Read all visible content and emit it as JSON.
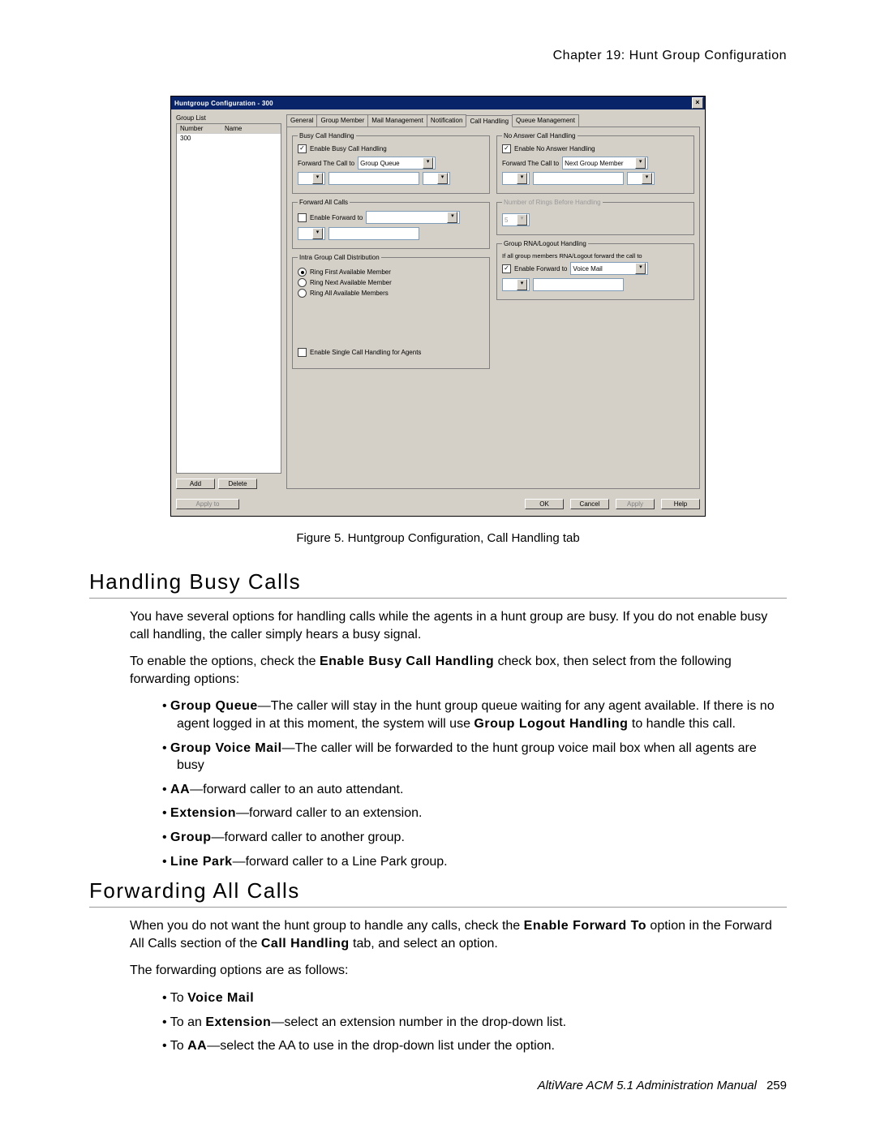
{
  "header": {
    "chapter": "Chapter 19:  Hunt Group Configuration"
  },
  "dialog": {
    "title": "Huntgroup Configuration - 300",
    "grouplist": {
      "label": "Group List",
      "col_number": "Number",
      "col_name": "Name",
      "row_number": "300",
      "add": "Add",
      "delete": "Delete"
    },
    "tabs": {
      "general": "General",
      "group_member": "Group Member",
      "mail_mgmt": "Mail Management",
      "notification": "Notification",
      "call_handling": "Call Handling",
      "queue_mgmt": "Queue Management"
    },
    "busy": {
      "legend": "Busy Call Handling",
      "enable": "Enable Busy Call Handling",
      "fwd_label": "Forward The Call to",
      "fwd_value": "Group Queue"
    },
    "fwdall": {
      "legend": "Forward All Calls",
      "enable": "Enable Forward to"
    },
    "intra": {
      "legend": "Intra Group Call Distribution",
      "r1": "Ring First Available Member",
      "r2": "Ring Next Available Member",
      "r3": "Ring All Available Members"
    },
    "single": "Enable Single Call Handling for Agents",
    "noanswer": {
      "legend": "No Answer Call Handling",
      "enable": "Enable No Answer Handling",
      "fwd_label": "Forward The Call to",
      "fwd_value": "Next Group Member"
    },
    "rings": {
      "legend": "Number of Rings Before Handling",
      "value": "5"
    },
    "rna": {
      "legend": "Group RNA/Logout Handling",
      "desc": "If all group members RNA/Logout forward the call to",
      "enable": "Enable Forward to",
      "value": "Voice Mail"
    },
    "buttons": {
      "applyto": "Apply to",
      "ok": "OK",
      "cancel": "Cancel",
      "apply": "Apply",
      "help": "Help"
    }
  },
  "caption": "Figure 5.    Huntgroup Configuration, Call Handling tab",
  "s1": {
    "title": "Handling Busy Calls",
    "p1a": "You have several options for handling calls while the agents in a hunt group are busy. If you do not enable busy call handling, the caller simply hears a busy signal.",
    "p2a": "To enable the options, check the ",
    "p2b": "Enable Busy Call Handling",
    "p2c": " check box, then select from the following forwarding options:",
    "b1a": "Group Queue",
    "b1b": "—The caller will stay in the hunt group queue waiting for any agent available. If there is no agent logged in at this moment, the system will use ",
    "b1c": "Group Logout Handling",
    "b1d": " to handle this call.",
    "b2a": "Group Voice Mail",
    "b2b": "—The caller will be forwarded to the hunt group voice mail box when all agents are busy",
    "b3a": "AA",
    "b3b": "—forward caller to an auto attendant.",
    "b4a": "Extension",
    "b4b": "—forward caller to an extension.",
    "b5a": "Group",
    "b5b": "—forward caller to another group.",
    "b6a": "Line Park",
    "b6b": "—forward caller to a Line Park group."
  },
  "s2": {
    "title": "Forwarding All Calls",
    "p1a": "When you do not want the hunt group to handle any calls, check the ",
    "p1b": "Enable Forward To",
    "p1c": " option in the Forward All Calls section of the ",
    "p1d": "Call Handling",
    "p1e": " tab, and select an option.",
    "p2": "The forwarding options are as follows:",
    "b1a": "To ",
    "b1b": "Voice Mail",
    "b2a": "To an ",
    "b2b": "Extension",
    "b2c": "—select an extension number in the drop-down list.",
    "b3a": "To ",
    "b3b": "AA",
    "b3c": "—select the AA to use in the drop-down list under the option."
  },
  "footer": {
    "text": "AltiWare ACM 5.1 Administration Manual",
    "page": "259"
  }
}
